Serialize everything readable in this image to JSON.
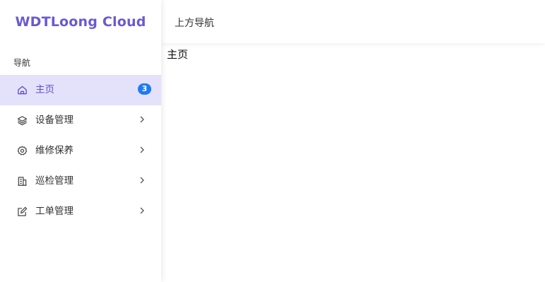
{
  "brand": {
    "title": "WDTLoong Cloud"
  },
  "sidebar": {
    "section_label": "导航",
    "items": [
      {
        "label": "主页",
        "icon": "home-icon",
        "badge": "3",
        "active": true
      },
      {
        "label": "设备管理",
        "icon": "layers-icon",
        "active": false
      },
      {
        "label": "维修保养",
        "icon": "gear-icon",
        "active": false
      },
      {
        "label": "巡检管理",
        "icon": "building-icon",
        "active": false
      },
      {
        "label": "工单管理",
        "icon": "edit-icon",
        "active": false
      }
    ]
  },
  "topbar": {
    "title": "上方导航"
  },
  "main": {
    "heading": "主页"
  },
  "colors": {
    "brand": "#6a5acd",
    "active_bg": "#e4e1fb",
    "active_text": "#5b4fcf",
    "badge": "#1e7bf0"
  }
}
